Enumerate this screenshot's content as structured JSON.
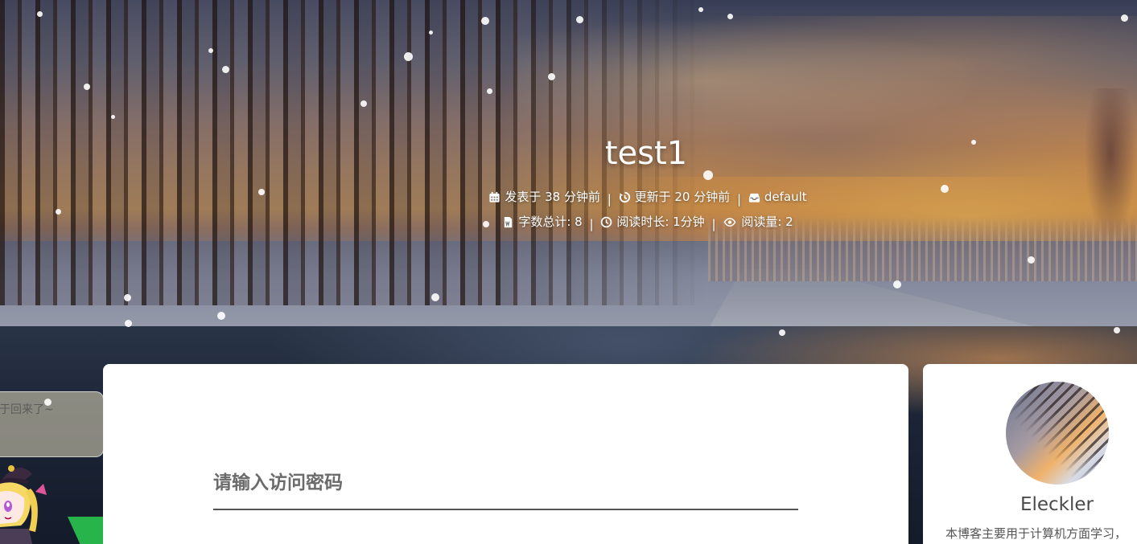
{
  "post": {
    "title": "test1",
    "published": "发表于 38 分钟前",
    "updated": "更新于 20 分钟前",
    "category": "default",
    "separator": "|",
    "word_count": "字数总计: 8",
    "read_time": "阅读时长: 1分钟",
    "views": "阅读量: 2"
  },
  "password_prompt": {
    "label": "请输入访问密码",
    "value": ""
  },
  "profile": {
    "author": "Eleckler",
    "bio": "本博客主要用于计算机方面学习，"
  },
  "mascot": {
    "message": "于回来了~"
  },
  "icons": {
    "calendar": "calendar-icon",
    "history": "history-icon",
    "category": "inbox-icon",
    "word_count": "file-word-icon",
    "clock": "clock-icon",
    "eye": "eye-icon"
  },
  "colors": {
    "card_bg": "#ffffff",
    "label_text": "#6b6b6b",
    "title_text": "#ffffff",
    "mascot_accent": "#27b44a"
  }
}
